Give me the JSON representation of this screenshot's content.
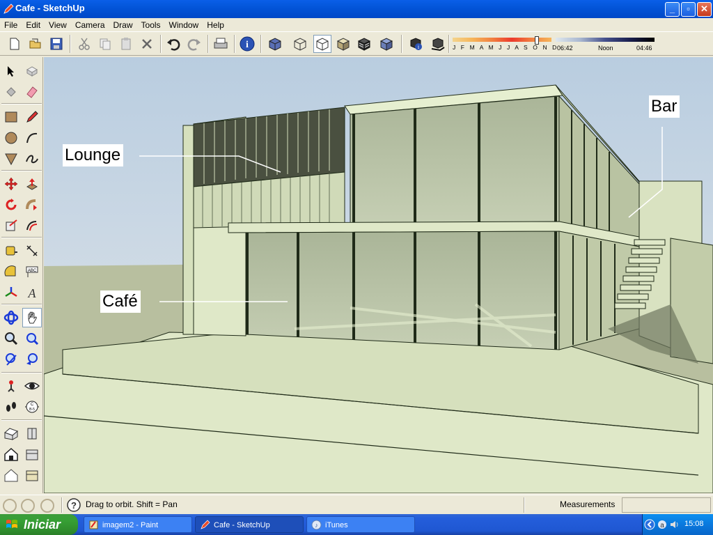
{
  "window": {
    "title": "Cafe - SketchUp",
    "icon": "sketchup-pencil-icon"
  },
  "menu": [
    "File",
    "Edit",
    "View",
    "Camera",
    "Draw",
    "Tools",
    "Window",
    "Help"
  ],
  "shadow_settings": {
    "months": "J F M A M J J A S O N D",
    "time_start": "06:42",
    "time_mid": "Noon",
    "time_end": "04:46"
  },
  "viewport": {
    "labels": {
      "lounge": "Lounge",
      "cafe": "Café",
      "bar": "Bar"
    },
    "colors": {
      "face": "#d9e5c3",
      "face_dark": "#aeb89a",
      "edge": "#1f2a18",
      "sky": "#c4d4e2",
      "ground": "#b7be9f"
    }
  },
  "status": {
    "hint": "Drag to orbit.  Shift = Pan",
    "measurements_label": "Measurements",
    "measurements_value": ""
  },
  "taskbar": {
    "start_label": "Iniciar",
    "tasks": [
      {
        "label": "imagem2 - Paint",
        "icon": "paint-icon"
      },
      {
        "label": "Cafe - SketchUp",
        "icon": "sketchup-icon"
      },
      {
        "label": "iTunes",
        "icon": "itunes-icon"
      }
    ],
    "clock": "15:08"
  }
}
